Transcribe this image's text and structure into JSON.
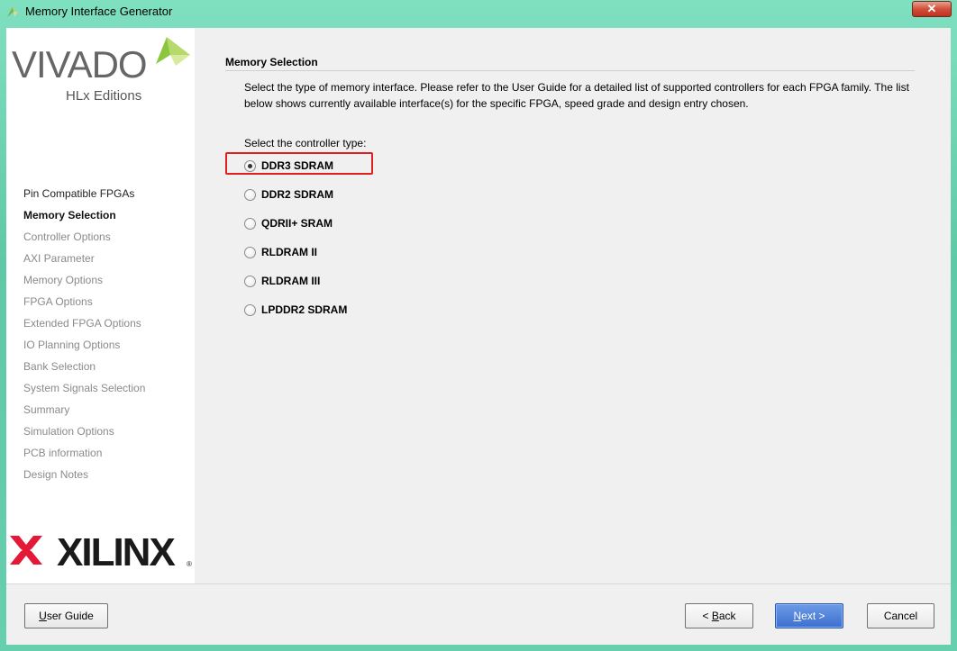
{
  "window": {
    "title": "Memory Interface Generator",
    "close_label": "✕",
    "app_icon": "vivado-app-icon"
  },
  "sidebar": {
    "logo_wordmark": "VIVADO",
    "logo_sub": "HLx Editions",
    "vendor_logo": "XILINX",
    "items": [
      {
        "label": "Pin Compatible FPGAs",
        "state": "done"
      },
      {
        "label": "Memory Selection",
        "state": "active"
      },
      {
        "label": "Controller Options",
        "state": "pending"
      },
      {
        "label": "AXI Parameter",
        "state": "pending"
      },
      {
        "label": "Memory Options",
        "state": "pending"
      },
      {
        "label": "FPGA Options",
        "state": "pending"
      },
      {
        "label": "Extended FPGA Options",
        "state": "pending"
      },
      {
        "label": "IO Planning Options",
        "state": "pending"
      },
      {
        "label": "Bank Selection",
        "state": "pending"
      },
      {
        "label": "System Signals Selection",
        "state": "pending"
      },
      {
        "label": "Summary",
        "state": "pending"
      },
      {
        "label": "Simulation Options",
        "state": "pending"
      },
      {
        "label": "PCB information",
        "state": "pending"
      },
      {
        "label": "Design Notes",
        "state": "pending"
      }
    ]
  },
  "main": {
    "section_title": "Memory Selection",
    "description": "Select the type of memory interface. Please refer to the User Guide for a detailed list of supported controllers for each FPGA family. The list below shows currently available interface(s) for the specific FPGA, speed grade and design entry chosen.",
    "controller_label": "Select the controller type:",
    "options": [
      {
        "label": "DDR3 SDRAM",
        "selected": true
      },
      {
        "label": "DDR2 SDRAM",
        "selected": false
      },
      {
        "label": "QDRII+ SRAM",
        "selected": false
      },
      {
        "label": "RLDRAM II",
        "selected": false
      },
      {
        "label": "RLDRAM III",
        "selected": false
      },
      {
        "label": "LPDDR2 SDRAM",
        "selected": false
      }
    ],
    "highlight_color": "#e02020"
  },
  "footer": {
    "user_guide": {
      "mnemonic": "U",
      "rest": "ser Guide"
    },
    "back": {
      "prefix": "< ",
      "mnemonic": "B",
      "rest": "ack"
    },
    "next": {
      "mnemonic": "N",
      "rest": "ext >"
    },
    "cancel": "Cancel"
  },
  "colors": {
    "accent": "#3b6fd0",
    "vivado_green": "#8cc63f",
    "xilinx_red": "#e31937"
  }
}
